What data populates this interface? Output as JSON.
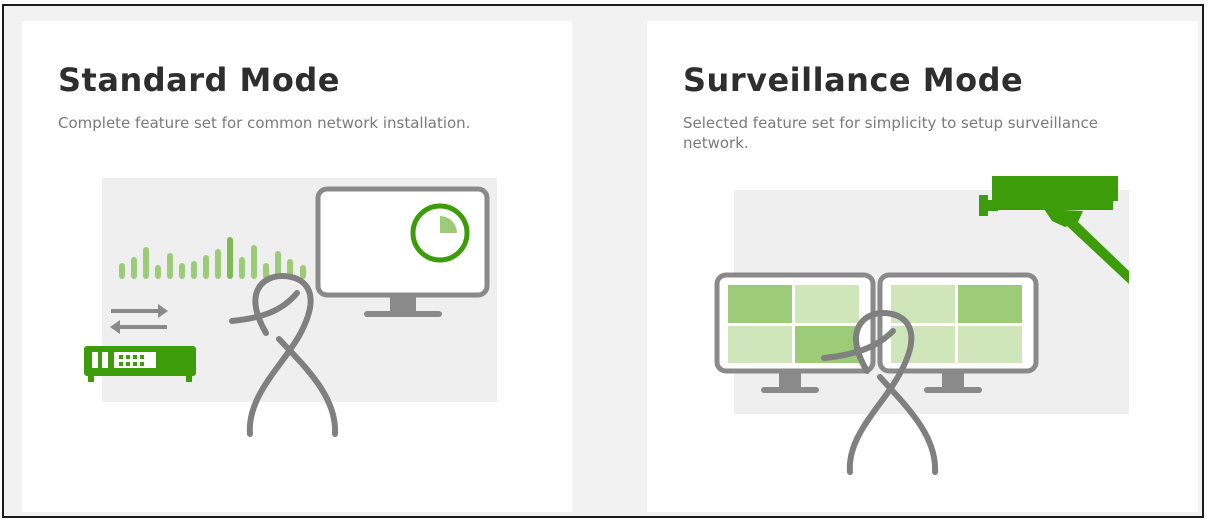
{
  "modes": [
    {
      "title": "Standard Mode",
      "description": "Complete feature set for common network installation.",
      "illustration": "network-admin-dashboard"
    },
    {
      "title": "Surveillance Mode",
      "description": "Selected feature set for simplicity to setup surveillance network.",
      "illustration": "surveillance-monitors-camera"
    }
  ],
  "colors": {
    "accent_green": "#3d9c0a",
    "light_green": "#9ccc78",
    "pale_green": "#cfe6bb",
    "outline_gray": "#8a8a8a",
    "panel_gray": "#efefef",
    "page_gray": "#f2f2f2"
  }
}
